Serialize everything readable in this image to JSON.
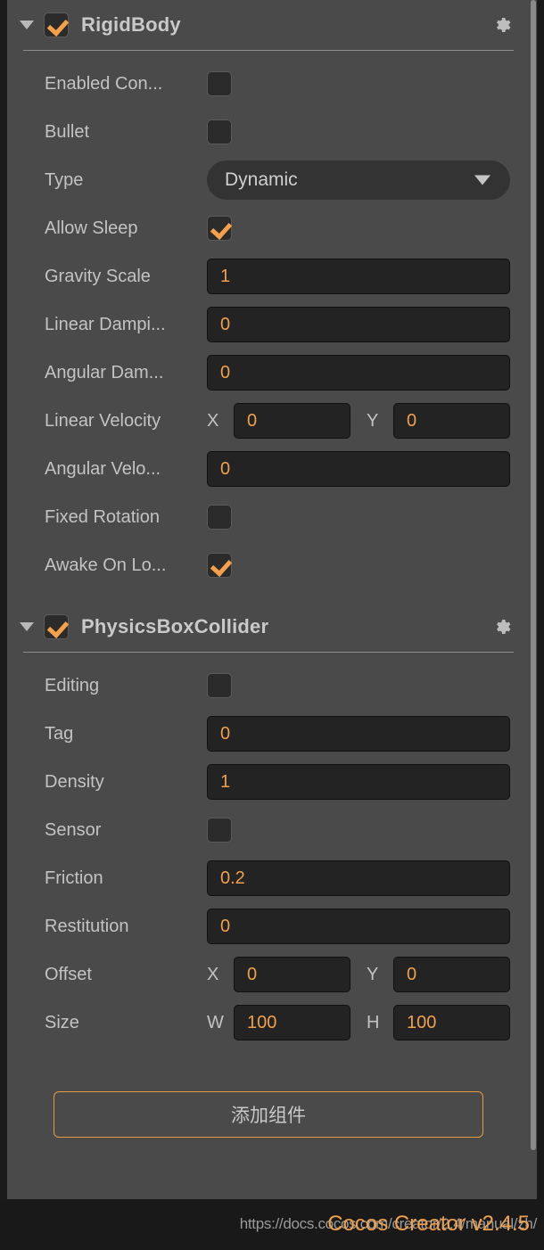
{
  "panel": {
    "name": "inspector-panel",
    "background_color": "#4a4a4a"
  },
  "theme": {
    "accent": "#f0a04b",
    "panel_bg": "#4a4a4a",
    "field_bg": "#232323",
    "label_color": "#c3c3c3",
    "title_color": "#c9c9c9",
    "statusbar_bg": "#191919"
  },
  "components": [
    {
      "title": "RigidBody",
      "enabled": true,
      "expanded": true,
      "settings_icon": "gear-icon",
      "fold_icon": "triangle-down-icon",
      "rows": [
        {
          "label": "Enabled Con...",
          "type": "checkbox",
          "checked": false
        },
        {
          "label": "Bullet",
          "type": "checkbox",
          "checked": false
        },
        {
          "label": "Type",
          "type": "dropdown",
          "value": "Dynamic"
        },
        {
          "label": "Allow Sleep",
          "type": "checkbox",
          "checked": true
        },
        {
          "label": "Gravity Scale",
          "type": "number",
          "value": "1"
        },
        {
          "label": "Linear Dampi...",
          "type": "number",
          "value": "0"
        },
        {
          "label": "Angular Dam...",
          "type": "number",
          "value": "0"
        },
        {
          "label": "Linear Velocity",
          "type": "pair",
          "a_label": "X",
          "a_value": "0",
          "b_label": "Y",
          "b_value": "0"
        },
        {
          "label": "Angular Velo...",
          "type": "number",
          "value": "0"
        },
        {
          "label": "Fixed Rotation",
          "type": "checkbox",
          "checked": false
        },
        {
          "label": "Awake On Lo...",
          "type": "checkbox",
          "checked": true
        }
      ]
    },
    {
      "title": "PhysicsBoxCollider",
      "enabled": true,
      "expanded": true,
      "settings_icon": "gear-icon",
      "fold_icon": "triangle-down-icon",
      "rows": [
        {
          "label": "Editing",
          "type": "checkbox",
          "checked": false
        },
        {
          "label": "Tag",
          "type": "number",
          "value": "0"
        },
        {
          "label": "Density",
          "type": "number",
          "value": "1"
        },
        {
          "label": "Sensor",
          "type": "checkbox",
          "checked": false
        },
        {
          "label": "Friction",
          "type": "number",
          "value": "0.2"
        },
        {
          "label": "Restitution",
          "type": "number",
          "value": "0"
        },
        {
          "label": "Offset",
          "type": "pair",
          "a_label": "X",
          "a_value": "0",
          "b_label": "Y",
          "b_value": "0"
        },
        {
          "label": "Size",
          "type": "pair",
          "a_label": "W",
          "a_value": "100",
          "b_label": "H",
          "b_value": "100"
        }
      ]
    }
  ],
  "add_component_button": {
    "label": "添加组件"
  },
  "statusbar": {
    "url_text": "https://docs.cocos.com/creator/2.4/manual/zh/",
    "version_text": "Cocos Creator v2.4.5"
  }
}
